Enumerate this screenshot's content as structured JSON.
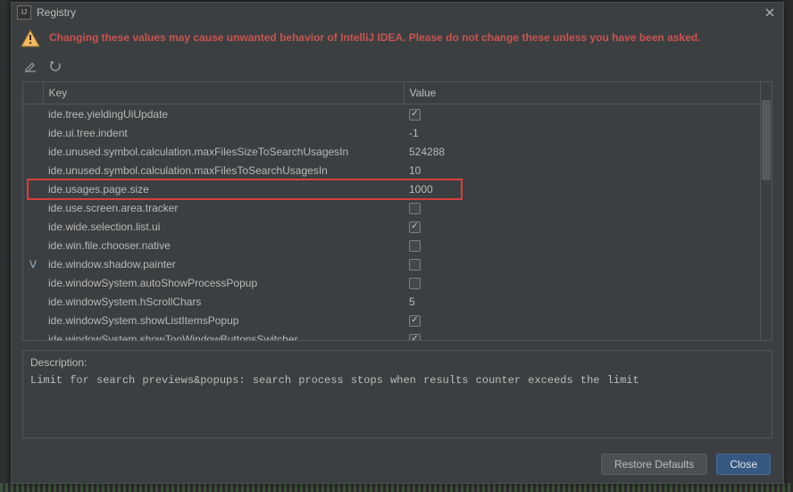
{
  "dialog": {
    "title": "Registry",
    "warning": "Changing these values may cause unwanted behavior of IntelliJ IDEA. Please do not change these unless you have been asked.",
    "columns": {
      "key": "Key",
      "value": "Value"
    },
    "rows": [
      {
        "mark": "",
        "key": "ide.tree.yieldingUiUpdate",
        "value_type": "bool",
        "checked": true
      },
      {
        "mark": "",
        "key": "ide.ui.tree.indent",
        "value_type": "text",
        "value": "-1"
      },
      {
        "mark": "",
        "key": "ide.unused.symbol.calculation.maxFilesSizeToSearchUsagesIn",
        "value_type": "text",
        "value": "524288"
      },
      {
        "mark": "",
        "key": "ide.unused.symbol.calculation.maxFilesToSearchUsagesIn",
        "value_type": "text",
        "value": "10"
      },
      {
        "mark": "",
        "key": "ide.usages.page.size",
        "value_type": "text",
        "value": "1000",
        "highlight": true
      },
      {
        "mark": "",
        "key": "ide.use.screen.area.tracker",
        "value_type": "bool",
        "checked": false
      },
      {
        "mark": "",
        "key": "ide.wide.selection.list.ui",
        "value_type": "bool",
        "checked": true
      },
      {
        "mark": "",
        "key": "ide.win.file.chooser.native",
        "value_type": "bool",
        "checked": false
      },
      {
        "mark": "V",
        "key": "ide.window.shadow.painter",
        "value_type": "bool",
        "checked": false
      },
      {
        "mark": "",
        "key": "ide.windowSystem.autoShowProcessPopup",
        "value_type": "bool",
        "checked": false
      },
      {
        "mark": "",
        "key": "ide.windowSystem.hScrollChars",
        "value_type": "text",
        "value": "5"
      },
      {
        "mark": "",
        "key": "ide.windowSystem.showListItemsPopup",
        "value_type": "bool",
        "checked": true
      },
      {
        "mark": "",
        "key": "ide.windowSystem.showTooWindowButtonsSwitcher",
        "value_type": "bool",
        "checked": true
      }
    ],
    "description": {
      "label": "Description:",
      "text": "Limit for search previews&popups: search process stops when results counter exceeds the limit"
    },
    "buttons": {
      "restore": "Restore Defaults",
      "close": "Close"
    }
  }
}
